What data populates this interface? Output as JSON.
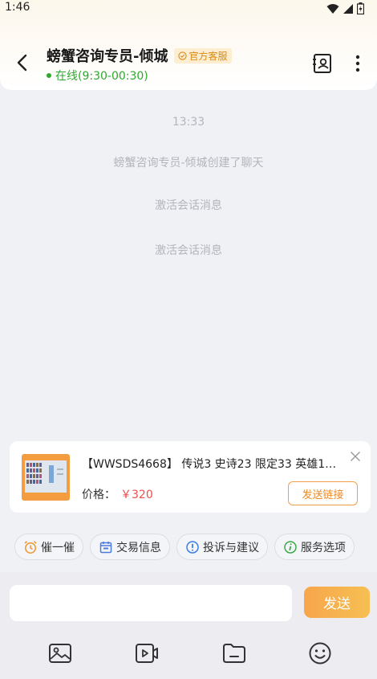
{
  "status_bar": {
    "time": "1:46"
  },
  "header": {
    "title": "螃蟹咨询专员-倾城",
    "badge": "官方客服",
    "online_status": "在线(9:30-00:30)"
  },
  "messages": [
    "13:33",
    "螃蟹咨询专员-倾城创建了聊天",
    "激活会话消息",
    "激活会话消息"
  ],
  "product_card": {
    "title": "【WWSDS4668】 传说3 史诗23 限定33 英雄1…",
    "price_label": "价格：",
    "price": "￥320",
    "send_link_label": "发送链接"
  },
  "quick_actions": [
    {
      "label": "催一催",
      "icon": "alarm-clock-icon"
    },
    {
      "label": "交易信息",
      "icon": "calendar-icon"
    },
    {
      "label": "投诉与建议",
      "icon": "exclamation-circle-icon"
    },
    {
      "label": "服务选项",
      "icon": "info-circle-icon"
    }
  ],
  "input": {
    "send_label": "发送"
  },
  "toolbar": [
    "image-icon",
    "video-icon",
    "folder-icon",
    "emoji-icon"
  ],
  "colors": {
    "accent": "#f6a84b",
    "online": "#2fa82f",
    "price": "#ef4d4d"
  }
}
